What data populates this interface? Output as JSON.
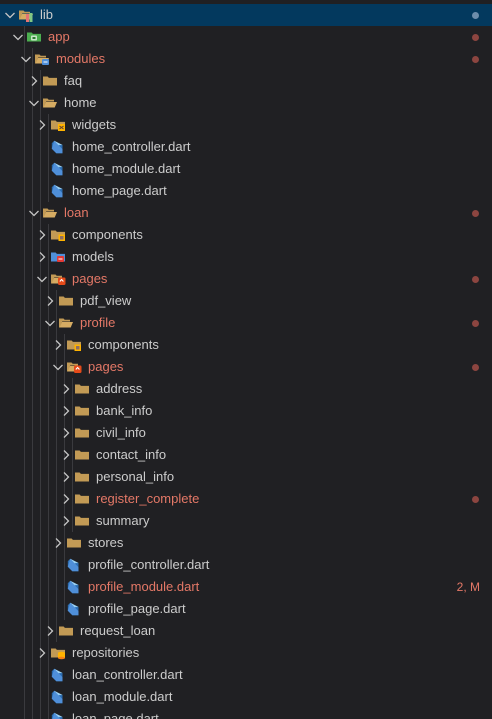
{
  "colors": {
    "background": "#202023",
    "selected_background": "#03395e",
    "text": "#cccccc",
    "modified_text": "#e47867",
    "modified_dot": "#8c4540",
    "folder": "#c29a55",
    "dart_icon": "#4f8fd9"
  },
  "tree": [
    {
      "label": "lib",
      "depth": 0,
      "twistie": "chevron-down-icon",
      "icon": "lib-folder-icon",
      "state": "selected",
      "decoration": "dot"
    },
    {
      "label": "app",
      "depth": 1,
      "twistie": "chevron-down-icon",
      "icon": "app-folder-icon",
      "state": "modified",
      "decoration": "dot"
    },
    {
      "label": "modules",
      "depth": 2,
      "twistie": "chevron-down-icon",
      "icon": "modules-folder-icon",
      "state": "modified",
      "decoration": "dot"
    },
    {
      "label": "faq",
      "depth": 3,
      "twistie": "chevron-right-icon",
      "icon": "folder-icon"
    },
    {
      "label": "home",
      "depth": 3,
      "twistie": "chevron-down-icon",
      "icon": "folder-open-icon"
    },
    {
      "label": "widgets",
      "depth": 4,
      "twistie": "chevron-right-icon",
      "icon": "widgets-folder-icon"
    },
    {
      "label": "home_controller.dart",
      "depth": 4,
      "icon": "dart-file-icon"
    },
    {
      "label": "home_module.dart",
      "depth": 4,
      "icon": "dart-file-icon"
    },
    {
      "label": "home_page.dart",
      "depth": 4,
      "icon": "dart-file-icon"
    },
    {
      "label": "loan",
      "depth": 3,
      "twistie": "chevron-down-icon",
      "icon": "folder-open-icon",
      "state": "modified",
      "decoration": "dot"
    },
    {
      "label": "components",
      "depth": 4,
      "twistie": "chevron-right-icon",
      "icon": "components-folder-icon"
    },
    {
      "label": "models",
      "depth": 4,
      "twistie": "chevron-right-icon",
      "icon": "models-folder-icon"
    },
    {
      "label": "pages",
      "depth": 4,
      "twistie": "chevron-down-icon",
      "icon": "pages-folder-icon",
      "state": "modified",
      "decoration": "dot"
    },
    {
      "label": "pdf_view",
      "depth": 5,
      "twistie": "chevron-right-icon",
      "icon": "folder-icon"
    },
    {
      "label": "profile",
      "depth": 5,
      "twistie": "chevron-down-icon",
      "icon": "folder-open-icon",
      "state": "modified",
      "decoration": "dot"
    },
    {
      "label": "components",
      "depth": 6,
      "twistie": "chevron-right-icon",
      "icon": "components-folder-icon"
    },
    {
      "label": "pages",
      "depth": 6,
      "twistie": "chevron-down-icon",
      "icon": "pages-folder-icon",
      "state": "modified",
      "decoration": "dot"
    },
    {
      "label": "address",
      "depth": 7,
      "twistie": "chevron-right-icon",
      "icon": "folder-icon"
    },
    {
      "label": "bank_info",
      "depth": 7,
      "twistie": "chevron-right-icon",
      "icon": "folder-icon"
    },
    {
      "label": "civil_info",
      "depth": 7,
      "twistie": "chevron-right-icon",
      "icon": "folder-icon"
    },
    {
      "label": "contact_info",
      "depth": 7,
      "twistie": "chevron-right-icon",
      "icon": "folder-icon"
    },
    {
      "label": "personal_info",
      "depth": 7,
      "twistie": "chevron-right-icon",
      "icon": "folder-icon"
    },
    {
      "label": "register_complete",
      "depth": 7,
      "twistie": "chevron-right-icon",
      "icon": "folder-icon",
      "state": "modified",
      "decoration": "dot"
    },
    {
      "label": "summary",
      "depth": 7,
      "twistie": "chevron-right-icon",
      "icon": "folder-icon"
    },
    {
      "label": "stores",
      "depth": 6,
      "twistie": "chevron-right-icon",
      "icon": "folder-icon"
    },
    {
      "label": "profile_controller.dart",
      "depth": 6,
      "icon": "dart-file-icon"
    },
    {
      "label": "profile_module.dart",
      "depth": 6,
      "icon": "dart-file-icon",
      "state": "modified",
      "decoration": "text",
      "decoration_text": "2, M"
    },
    {
      "label": "profile_page.dart",
      "depth": 6,
      "icon": "dart-file-icon"
    },
    {
      "label": "request_loan",
      "depth": 5,
      "twistie": "chevron-right-icon",
      "icon": "folder-icon"
    },
    {
      "label": "repositories",
      "depth": 4,
      "twistie": "chevron-right-icon",
      "icon": "repositories-folder-icon"
    },
    {
      "label": "loan_controller.dart",
      "depth": 4,
      "icon": "dart-file-icon"
    },
    {
      "label": "loan_module.dart",
      "depth": 4,
      "icon": "dart-file-icon"
    },
    {
      "label": "loan_page.dart",
      "depth": 4,
      "icon": "dart-file-icon"
    }
  ]
}
